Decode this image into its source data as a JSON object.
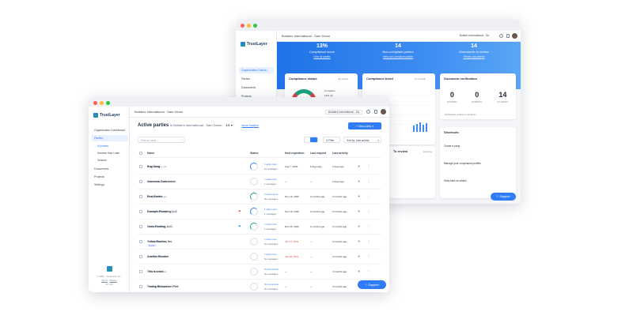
{
  "app": {
    "logo": "TrustLayer"
  },
  "back_window": {
    "breadcrumb": "Builders International - Sam Demo",
    "org_select": "Builder International - Sa",
    "nav": [
      "Organization Dashb...",
      "Parties",
      "Documents",
      "Projects",
      "Settings"
    ],
    "stats": [
      {
        "value": "13%",
        "label": "Compliance score",
        "link": "View all parties"
      },
      {
        "value": "14",
        "label": "Non-compliant parties",
        "link": "View non-compliant parties"
      },
      {
        "value": "14",
        "label": "Documents to review",
        "link": "Review documents"
      }
    ],
    "compliance_status": {
      "title": "Compliance status",
      "filter": "All parties",
      "legend": "Compliant",
      "legend_value": "13% (2)"
    },
    "compliance_trend": {
      "title": "Compliance trend",
      "range": "12 months"
    },
    "document_verification": {
      "title": "Document verification",
      "items": [
        {
          "value": "0",
          "label": "EXPIRED"
        },
        {
          "value": "0",
          "label": "EXPIRING"
        },
        {
          "value": "14",
          "label": "TO VERIFY"
        }
      ],
      "note": "Notifications enabled on all parties"
    },
    "to_review": {
      "title": "To review",
      "subtitle": "Expiring"
    },
    "shortcuts": {
      "title": "Shortcuts",
      "items": [
        "Create a party",
        "Manage your compliance profiles",
        "Keep tabs on what's"
      ]
    },
    "support_label": "Support"
  },
  "front_window": {
    "breadcrumb": "Builders International - Sam Demo",
    "org_select": "Builders International - Sa",
    "nav": {
      "dashboard": "Organization Dashboard",
      "parties": "Parties",
      "sub": [
        "All parties",
        "Hammer Man Loam",
        "Vendors"
      ],
      "documents": "Documents",
      "projects": "Projects",
      "settings": "Settings"
    },
    "footer": {
      "copyright": "© 2021 - TrustLayer, Inc.",
      "terms": "Terms",
      "privacy": "Privacy",
      "version": "v2.0.16"
    },
    "heading": {
      "title": "Active parties",
      "in": "in Builders International - Sam Demo",
      "count": "14",
      "inactive": "show inactive"
    },
    "new_party": "New party",
    "search_placeholder": "Find by name...",
    "filter": "Filter",
    "sort": "Sort by: Last activity",
    "columns": {
      "name": "Name",
      "status": "Status",
      "next_expiration": "Next expiration",
      "last_request": "Last request",
      "last_activity": "Last activity"
    },
    "rows": [
      {
        "name": "Bug Gang",
        "type": "Fannie Mae Loan",
        "tag": "",
        "actions": "1 action item",
        "messages": "10 messages",
        "expiration": "Aug 7, 2026",
        "exp_red": false,
        "last_request": "6 days ago",
        "last_activity": "3 days ago"
      },
      {
        "name": "Awesome Contractors",
        "type": "Fannie Mae Loan",
        "tag": "",
        "actions": "1 action item",
        "messages": "1 messages",
        "expiration": "—",
        "exp_red": false,
        "last_request": "—",
        "last_activity": "3 days ago"
      },
      {
        "name": "Best Roofer",
        "type": "Fannie Mae Loan",
        "tag": "",
        "actions": "2 action items",
        "messages": "No messages",
        "expiration": "Nov 19, 2020",
        "exp_red": false,
        "last_request": "2 months ago",
        "last_activity": "2 months ago"
      },
      {
        "name": "Example Plumbing LLC",
        "type": "Fannie Mae Loan",
        "tag": "",
        "actions": "1 action item",
        "messages": "1 messages",
        "expiration": "Nov 19, 2020",
        "exp_red": false,
        "last_request": "2 months ago",
        "last_activity": "2 months ago"
      },
      {
        "name": "Zumo Roofing, LLC.",
        "type": "Fannie Mae Loan",
        "tag": "",
        "actions": "1 action item",
        "messages": "1 messages",
        "expiration": "Dec 30, 2020",
        "exp_red": false,
        "last_request": "2 months ago",
        "last_activity": "2 months ago"
      },
      {
        "name": "Yellow Roofers, Inc.",
        "type": "Fannie Mae Loan",
        "tag": "Roofer",
        "actions": "1 action item",
        "messages": "No messages",
        "expiration": "Jan 07, 2021",
        "exp_red": true,
        "last_request": "—",
        "last_activity": "2 months ago"
      },
      {
        "name": "Another Plumber",
        "type": "Fannie Mae Loan",
        "tag": "",
        "actions": "1 action item",
        "messages": "No messages",
        "expiration": "Jan 06, 2021",
        "exp_red": true,
        "last_request": "—",
        "last_activity": "2 months ago"
      },
      {
        "name": "This is a test",
        "type": "Fannie Mae Loan",
        "tag": "",
        "actions": "No documents",
        "messages": "No messages",
        "expiration": "—",
        "exp_red": false,
        "last_request": "—",
        "last_activity": "2 months ago"
      },
      {
        "name": "Testing Richardson Peet",
        "type": "Fannie Mae Loan",
        "tag": "",
        "actions": "No documents",
        "messages": "No messages",
        "expiration": "—",
        "exp_red": false,
        "last_request": "—",
        "last_activity": "3 months ago"
      }
    ],
    "support_label": "Support"
  },
  "colors": {
    "accent": "#2f7cf6",
    "hero_gradient_start": "#1f72e8",
    "danger": "#e0403a",
    "success": "#1aa37a"
  }
}
